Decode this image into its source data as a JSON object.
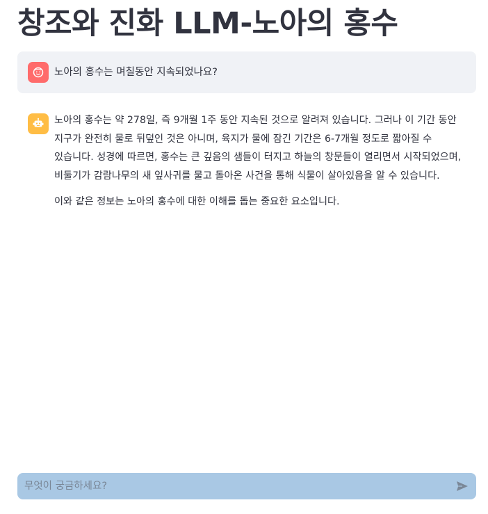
{
  "page": {
    "title": "창조와 진화 LLM-노아의 홍수"
  },
  "chat": {
    "messages": [
      {
        "role": "user",
        "avatar_icon": "user-face-icon",
        "avatar_color": "#ff6b6b",
        "text": "노아의 홍수는 며칠동안 지속되었나요?"
      },
      {
        "role": "assistant",
        "avatar_icon": "robot-icon",
        "avatar_color": "#ffbd45",
        "paragraphs": [
          "노아의 홍수는 약 278일, 즉 9개월 1주 동안 지속된 것으로 알려져 있습니다. 그러나 이 기간 동안 지구가 완전히 물로 뒤덮인 것은 아니며, 육지가 물에 잠긴 기간은 6-7개월 정도로 짧아질 수 있습니다. 성경에 따르면, 홍수는 큰 깊음의 샘들이 터지고 하늘의 창문들이 열리면서 시작되었으며, 비둘기가 감람나무의 새 잎사귀를 물고 돌아온 사건을 통해 식물이 살아있음을 알 수 있습니다.",
          "이와 같은 정보는 노아의 홍수에 대한 이해를 돕는 중요한 요소입니다."
        ]
      }
    ]
  },
  "input": {
    "placeholder": "무엇이 궁금하세요?",
    "value": "",
    "send_icon": "send-icon",
    "background": "#a9c8e4"
  }
}
